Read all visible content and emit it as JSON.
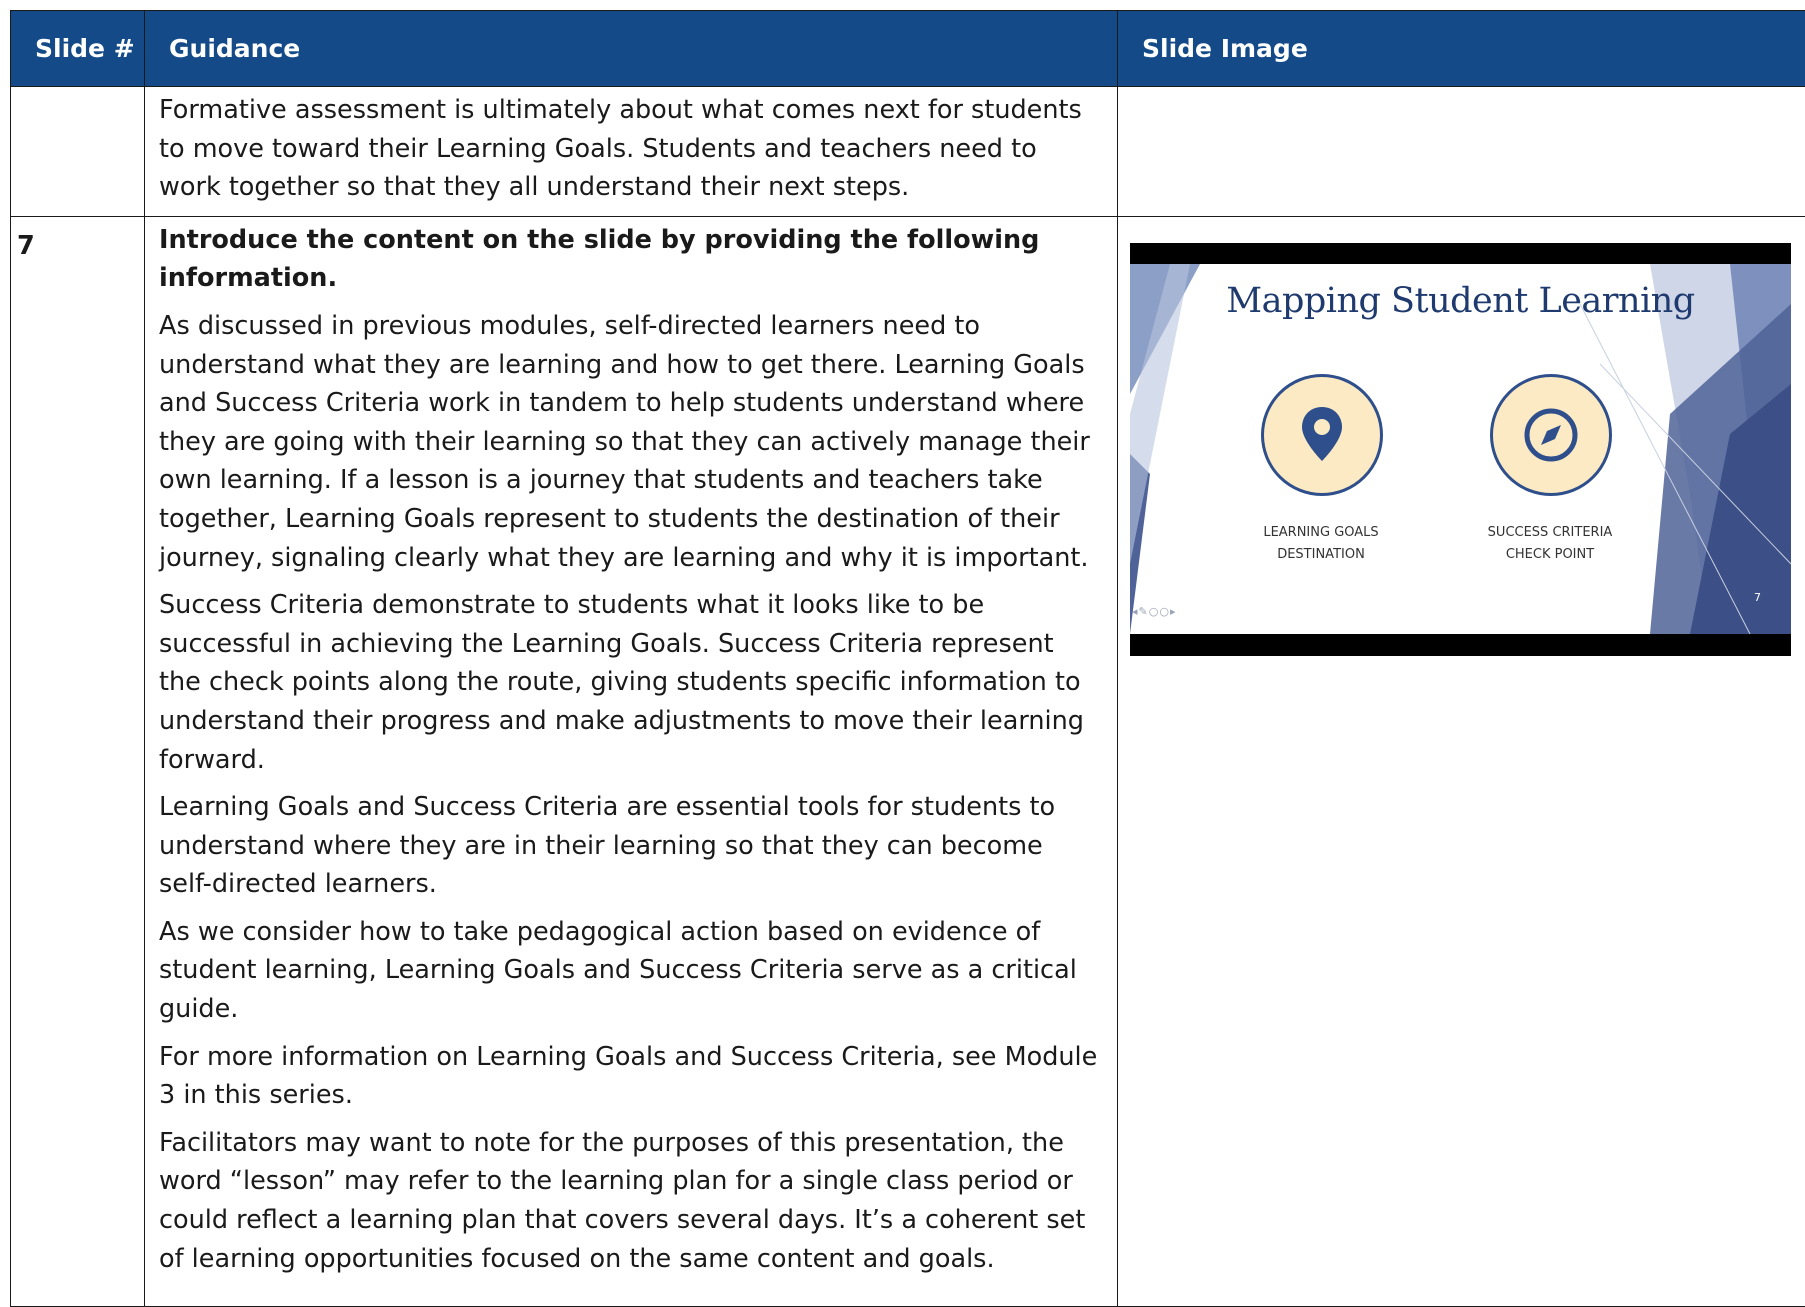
{
  "table": {
    "headers": {
      "slide_num": "Slide #",
      "guidance": "Guidance",
      "slide_image": "Slide Image"
    },
    "rows": [
      {
        "slide_num": "",
        "paragraphs": [
          "Formative assessment is ultimately about what comes next for students to move toward their Learning Goals. Students and teachers need to work together so that they all understand their next steps."
        ]
      },
      {
        "slide_num": "7",
        "lead": "Introduce the content on the slide by providing the following information.",
        "paragraphs": [
          "As discussed in previous modules, self-directed learners need to understand what they are learning and how to get there. Learning Goals and Success Criteria work in tandem to help students understand where they are going with their learning so that they can actively manage their own learning. If a lesson is a journey that students and teachers take together, Learning Goals represent to students the destination of their journey, signaling clearly what they are learning and why it is important.",
          "Success Criteria demonstrate to students what it looks like to be successful in achieving the Learning Goals. Success Criteria represent the check points along the route, giving students specific information to understand their progress and make adjustments to move their learning forward.",
          "Learning Goals and Success Criteria are essential tools for students to understand where they are in their learning so that they can become self-directed learners.",
          "As we consider how to take pedagogical action based on evidence of student learning, Learning Goals and Success Criteria serve as a critical guide.",
          "For more information on Learning Goals and Success Criteria, see Module 3 in this series.",
          "Facilitators may want to note for the purposes of this presentation, the word “lesson” may refer to the learning plan for a single class period or could reflect a learning plan that covers several days. It’s a coherent set of learning opportunities focused on the same content and goals."
        ]
      }
    ]
  },
  "slide": {
    "title": "Mapping Student Learning",
    "left_item": {
      "icon": "map-pin-icon",
      "line1": "LEARNING GOALS",
      "line2": "DESTINATION"
    },
    "right_item": {
      "icon": "compass-icon",
      "line1": "SUCCESS CRITERIA",
      "line2": "CHECK POINT"
    },
    "page_number": "7",
    "colors": {
      "title": "#1f3a6e",
      "circle_fill": "#fbeac3",
      "circle_stroke": "#2f4f8c",
      "header_bg": "#134a87"
    }
  }
}
